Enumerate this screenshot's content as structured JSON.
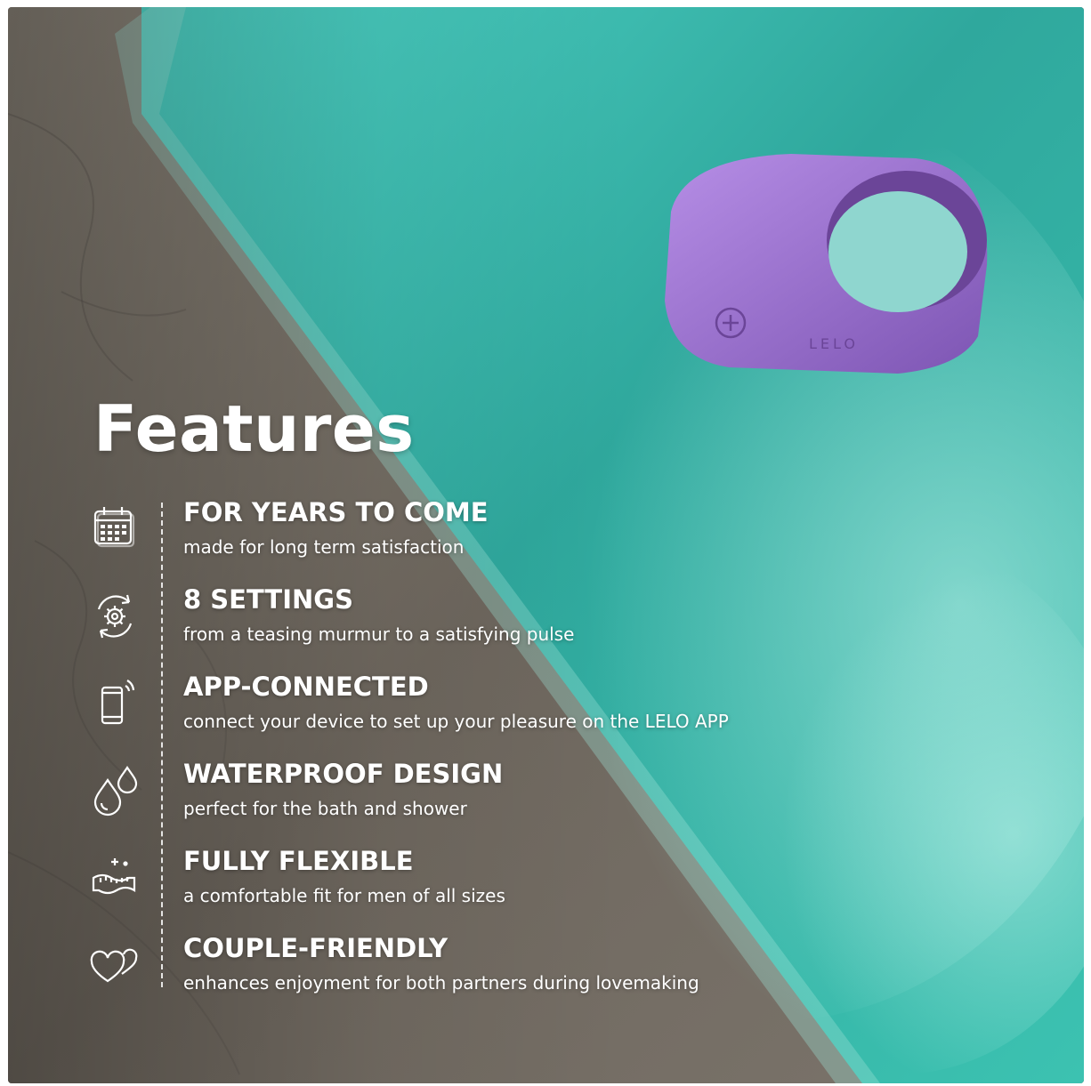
{
  "title": "Features",
  "brand_mark": "LELO",
  "colors": {
    "text": "#ffffff",
    "ring": "#9a6fd0",
    "water": "#3ec4b4",
    "stone": "#7a7369"
  },
  "features": [
    {
      "icon": "calendar-icon",
      "title": "FOR YEARS TO COME",
      "description": "made for long term satisfaction"
    },
    {
      "icon": "gear-cycle-icon",
      "title": "8 SETTINGS",
      "description": "from a teasing murmur to a satisfying pulse"
    },
    {
      "icon": "phone-signal-icon",
      "title": "APP-CONNECTED",
      "description": "connect your device to set up your pleasure on the LELO APP"
    },
    {
      "icon": "water-drops-icon",
      "title": "WATERPROOF DESIGN",
      "description": "perfect for the bath and shower"
    },
    {
      "icon": "measuring-tape-icon",
      "title": "FULLY FLEXIBLE",
      "description": "a comfortable fit for men of all sizes"
    },
    {
      "icon": "two-hearts-icon",
      "title": "COUPLE-FRIENDLY",
      "description": "enhances enjoyment for both partners during lovemaking"
    }
  ]
}
